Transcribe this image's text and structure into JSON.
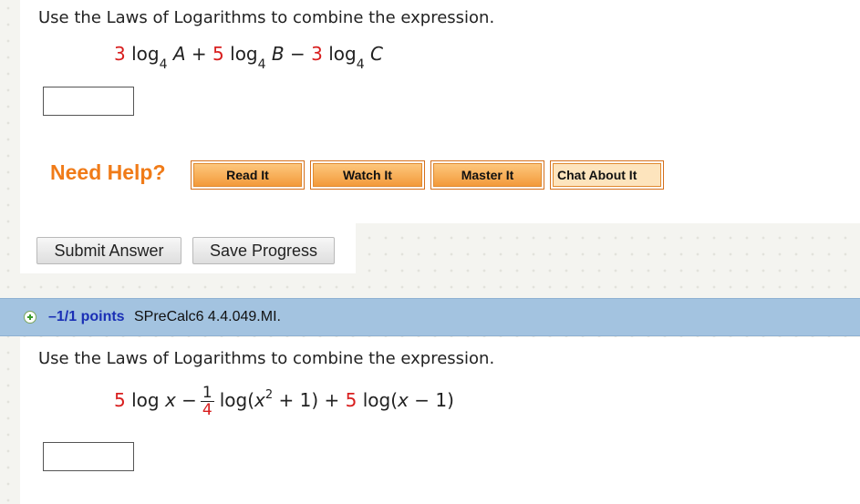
{
  "question1": {
    "prompt": "Use the Laws of Logarithms to combine the expression.",
    "expr": {
      "c1": "3",
      "log1": "log",
      "b1": "4",
      "v1": "A",
      "op1": "+",
      "c2": "5",
      "log2": "log",
      "b2": "4",
      "v2": "B",
      "op2": "−",
      "c3": "3",
      "log3": "log",
      "b3": "4",
      "v3": "C"
    },
    "answer_value": ""
  },
  "help": {
    "label": "Need Help?",
    "buttons": [
      "Read It",
      "Watch It",
      "Master It",
      "Chat About It"
    ]
  },
  "actions": {
    "submit": "Submit Answer",
    "save": "Save Progress"
  },
  "question2": {
    "points": "–1/1 points",
    "id": "SPreCalc6 4.4.049.MI.",
    "prompt": "Use the Laws of Logarithms to combine the expression.",
    "expr": {
      "c1": "5",
      "t1": "log",
      "v1": "x",
      "op1": "−",
      "num": "1",
      "den": "4",
      "t2a": "log(",
      "v2": "x",
      "exp": "2",
      "t2b": " + 1)",
      "op2": " + ",
      "c3": "5",
      "t3a": " log(",
      "v3": "x",
      "t3b": " − 1)"
    },
    "answer_value": ""
  },
  "colors": {
    "accent_orange": "#f07b18",
    "coefficient_red": "#d81e1e",
    "bar_blue": "#a3c3e0",
    "points_blue": "#1a2fb5"
  }
}
